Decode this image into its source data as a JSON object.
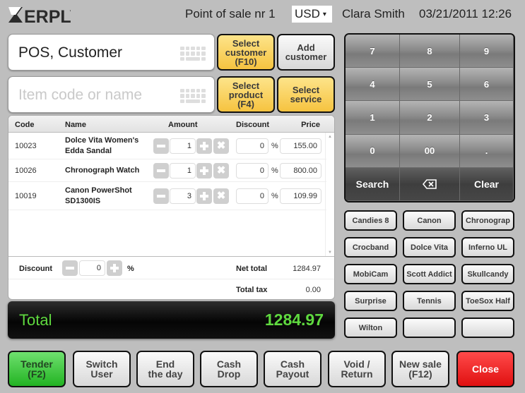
{
  "header": {
    "logo_text": "ERPLY",
    "pos_title": "Point of sale nr 1",
    "currency": "USD",
    "user": "Clara Smith",
    "datetime": "03/21/2011 12:26"
  },
  "customer_field": {
    "value": "POS, Customer",
    "icon": "keyboard-icon"
  },
  "item_field": {
    "placeholder": "Item code or name",
    "icon": "keyboard-icon"
  },
  "action_buttons": {
    "select_customer": "Select\ncustomer\n(F10)",
    "add_customer": "Add\ncustomer",
    "select_product": "Select\nproduct\n(F4)",
    "select_service": "Select\nservice"
  },
  "cart": {
    "columns": [
      "Code",
      "Name",
      "Amount",
      "Discount",
      "Price"
    ],
    "rows": [
      {
        "code": "10023",
        "name": "Dolce Vita Women's Edda Sandal",
        "amount": "1",
        "discount": "0",
        "price": "155.00"
      },
      {
        "code": "10026",
        "name": "Chronograph Watch",
        "amount": "1",
        "discount": "0",
        "price": "800.00"
      },
      {
        "code": "10019",
        "name": "Canon PowerShot SD1300IS",
        "amount": "3",
        "discount": "0",
        "price": "109.99"
      }
    ],
    "percent_sign": "%",
    "discount_label": "Discount",
    "discount_value": "0",
    "net_total_label": "Net total",
    "net_total_value": "1284.97",
    "total_tax_label": "Total tax",
    "total_tax_value": "0.00"
  },
  "total": {
    "label": "Total",
    "value": "1284.97",
    "color": "#5fd93f"
  },
  "keypad": {
    "keys": [
      "7",
      "8",
      "9",
      "4",
      "5",
      "6",
      "1",
      "2",
      "3",
      "0",
      "00",
      "."
    ],
    "search": "Search",
    "backspace_icon": "backspace-icon",
    "clear": "Clear"
  },
  "product_buttons": [
    "Candies 8",
    "Canon",
    "Chronograp",
    "Crocband",
    "Dolce Vita",
    "Inferno UL",
    "MobiCam",
    "Scott Addict",
    "Skullcandy",
    "Surprise",
    "Tennis",
    "ToeSox Half",
    "Wilton",
    "",
    ""
  ],
  "bottom_bar": {
    "tender": "Tender\n(F2)",
    "switch_user": "Switch\nUser",
    "end_day": "End\nthe day",
    "cash_drop": "Cash\nDrop",
    "cash_payout": "Cash\nPayout",
    "void_return": "Void /\nReturn",
    "new_sale": "New sale\n(F12)",
    "close": "Close"
  },
  "colors": {
    "accent_yellow": "#f6c340",
    "tender_green": "#22b322",
    "close_red": "#e01010"
  }
}
